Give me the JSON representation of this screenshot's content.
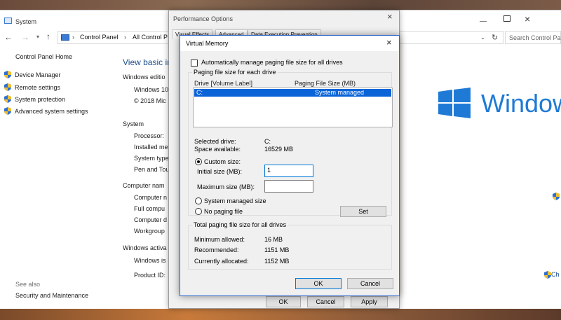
{
  "system_window": {
    "title": "System",
    "address": {
      "separator": "›",
      "crumb1": "Control Panel",
      "crumb2": "All Control P",
      "search_placeholder": "Search Control Panel"
    },
    "sidebar": {
      "home": "Control Panel Home",
      "items": [
        {
          "label": "Device Manager"
        },
        {
          "label": "Remote settings"
        },
        {
          "label": "System protection"
        },
        {
          "label": "Advanced system settings"
        }
      ],
      "see_also": "See also",
      "security": "Security and Maintenance"
    },
    "main": {
      "heading": "View basic in",
      "edition_heading": "Windows editio",
      "edition_rows": [
        "Windows 10",
        "© 2018 Mic"
      ],
      "system_heading": "System",
      "system_rows": [
        "Processor:",
        "Installed me",
        "System type",
        "Pen and Tou"
      ],
      "computer_heading": "Computer nam",
      "computer_rows": [
        "Computer n",
        "Full compu",
        "Computer d",
        "Workgroup"
      ],
      "activation_heading": "Windows activa",
      "activation_rows": [
        "Windows is",
        "Product ID:"
      ],
      "logo_text": "Window",
      "change_link": "Ch"
    }
  },
  "perf_dialog": {
    "title": "Performance Options",
    "tabs": [
      "Visual Effects",
      "Advanced",
      "Data Execution Prevention"
    ],
    "ok": "OK",
    "cancel": "Cancel",
    "apply": "Apply"
  },
  "vm_dialog": {
    "title": "Virtual Memory",
    "auto_manage_label": "Automatically manage paging file size for all drives",
    "auto_manage_checked": false,
    "group1_label": "Paging file size for each drive",
    "col_drive": "Drive  [Volume Label]",
    "col_size": "Paging File Size (MB)",
    "drives": [
      {
        "drive": "C:",
        "size": "System managed",
        "selected": true
      }
    ],
    "selected_drive_label": "Selected drive:",
    "selected_drive_value": "C:",
    "space_label": "Space available:",
    "space_value": "16529 MB",
    "custom_size_label": "Custom size:",
    "initial_label": "Initial size (MB):",
    "initial_value": "1",
    "max_label": "Maximum size (MB):",
    "max_value": "",
    "system_managed_label": "System managed size",
    "no_paging_label": "No paging file",
    "selected_option": "custom",
    "set_label": "Set",
    "group2_label": "Total paging file size for all drives",
    "min_allowed_label": "Minimum allowed:",
    "min_allowed_value": "16 MB",
    "recommended_label": "Recommended:",
    "recommended_value": "1151 MB",
    "allocated_label": "Currently allocated:",
    "allocated_value": "1152 MB",
    "ok": "OK",
    "cancel": "Cancel"
  },
  "colors": {
    "accent": "#0078d7",
    "selection": "#0a64d8",
    "link": "#1e4e8c",
    "windows_logo": "#1f7ad6"
  },
  "icons": [
    "shield-icon",
    "search-icon",
    "refresh-icon",
    "close-icon",
    "windows-logo-icon",
    "computer-icon"
  ]
}
